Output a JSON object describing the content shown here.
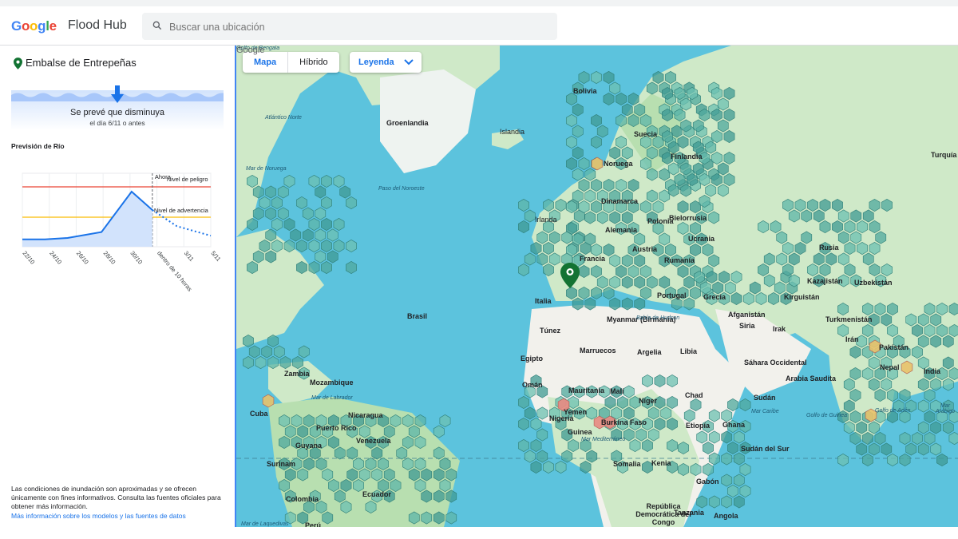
{
  "header": {
    "logo_letters": [
      "G",
      "o",
      "o",
      "g",
      "l",
      "e"
    ],
    "logo_colors": [
      "#4285f4",
      "#ea4335",
      "#fbbc05",
      "#4285f4",
      "#34a853",
      "#ea4335"
    ],
    "product": "Flood Hub",
    "search_placeholder": "Buscar una ubicación"
  },
  "sidebar": {
    "location": "Embalse de Entrepeñas",
    "forecast_title": "Se prevé que disminuya",
    "forecast_sub": "el día 6/11 o antes",
    "section_label": "Previsión de Río",
    "disclaimer": "Las condiciones de inundación son aproximadas y se ofrecen únicamente con fines informativos. Consulta las fuentes oficiales para obtener más información.",
    "more_link": "Más información sobre los modelos y las fuentes de datos"
  },
  "chart_data": {
    "type": "line",
    "x": [
      "22/10",
      "24/10",
      "26/10",
      "28/10",
      "30/10",
      "dentro de 10 horas",
      "3/11",
      "5/11"
    ],
    "annotations": [
      "Ahora",
      "Nivel de peligro",
      "Nivel de advertencia"
    ],
    "danger_color": "#ea4335",
    "warning_color": "#fbbc05",
    "line_color": "#1a73e8",
    "series": [
      {
        "values": [
          0.1,
          0.1,
          0.12,
          0.2,
          0.75,
          0.5
        ]
      },
      {
        "values": [
          0.5,
          0.28,
          0.15
        ]
      }
    ]
  },
  "map": {
    "view_tabs": [
      "Mapa",
      "Híbrido"
    ],
    "legend_label": "Leyenda",
    "labels": [
      {
        "t": "Groenlandia",
        "b": true
      },
      {
        "t": "Islandia"
      },
      {
        "t": "Irlanda"
      },
      {
        "t": "Noruega",
        "b": true
      },
      {
        "t": "Suecia",
        "b": true
      },
      {
        "t": "Finlandia",
        "b": true
      },
      {
        "t": "Dinamarca",
        "b": true
      },
      {
        "t": "Polonia",
        "b": true
      },
      {
        "t": "Alemania",
        "b": true
      },
      {
        "t": "Bielorrusia",
        "b": true
      },
      {
        "t": "Ucrania",
        "b": true
      },
      {
        "t": "Francia",
        "b": true
      },
      {
        "t": "Austria",
        "b": true
      },
      {
        "t": "Rumanía",
        "b": true
      },
      {
        "t": "Italia",
        "b": true
      },
      {
        "t": "Portugal",
        "b": true
      },
      {
        "t": "Grecia",
        "b": true
      },
      {
        "t": "Turquía",
        "b": true
      },
      {
        "t": "Rusia",
        "b": true
      },
      {
        "t": "Kazajistán",
        "b": true
      },
      {
        "t": "Uzbekistán",
        "b": true
      },
      {
        "t": "Kirguistán",
        "b": true
      },
      {
        "t": "Turkmenistán",
        "b": true
      },
      {
        "t": "Afganistán",
        "b": true
      },
      {
        "t": "Siria",
        "b": true
      },
      {
        "t": "Irak",
        "b": true
      },
      {
        "t": "Irán",
        "b": true
      },
      {
        "t": "Pakistán",
        "b": true
      },
      {
        "t": "Nepal",
        "b": true
      },
      {
        "t": "India",
        "b": true
      },
      {
        "t": "Myanmar (Birmania)",
        "b": true
      },
      {
        "t": "Túnez",
        "b": true
      },
      {
        "t": "Marruecos",
        "b": true
      },
      {
        "t": "Argelia",
        "b": true
      },
      {
        "t": "Libia",
        "b": true
      },
      {
        "t": "Egipto",
        "b": true
      },
      {
        "t": "Sáhara Occidental",
        "b": true
      },
      {
        "t": "Arabia Saudita",
        "b": true
      },
      {
        "t": "Omán",
        "b": true
      },
      {
        "t": "Mauritania",
        "b": true
      },
      {
        "t": "Malí",
        "b": true
      },
      {
        "t": "Níger",
        "b": true
      },
      {
        "t": "Chad",
        "b": true
      },
      {
        "t": "Sudán",
        "b": true
      },
      {
        "t": "Yemen",
        "b": true
      },
      {
        "t": "Burkina Faso",
        "b": true
      },
      {
        "t": "Nigeria",
        "b": true
      },
      {
        "t": "Guinea",
        "b": true
      },
      {
        "t": "Ghana",
        "b": true
      },
      {
        "t": "Etiopía",
        "b": true
      },
      {
        "t": "Sudán del Sur",
        "b": true
      },
      {
        "t": "Somalia",
        "b": true
      },
      {
        "t": "Kenia",
        "b": true
      },
      {
        "t": "Gabón",
        "b": true
      },
      {
        "t": "República Democrática del Congo",
        "b": true
      },
      {
        "t": "Tanzania",
        "b": true
      },
      {
        "t": "Angola",
        "b": true
      },
      {
        "t": "Zambia",
        "b": true
      },
      {
        "t": "Mozambique",
        "b": true
      },
      {
        "t": "Cuba",
        "b": true
      },
      {
        "t": "Puerto Rico",
        "b": true
      },
      {
        "t": "Nicaragua",
        "b": true
      },
      {
        "t": "Venezuela",
        "b": true
      },
      {
        "t": "Guyana",
        "b": true
      },
      {
        "t": "Surinam",
        "b": true
      },
      {
        "t": "Colombia",
        "b": true
      },
      {
        "t": "Ecuador",
        "b": true
      },
      {
        "t": "Perú",
        "b": true
      },
      {
        "t": "Brasil",
        "b": true
      },
      {
        "t": "Bolivia",
        "b": true
      },
      {
        "t": "Atlántico Norte",
        "sea": true
      },
      {
        "t": "Mar de Noruega",
        "sea": true
      },
      {
        "t": "Paso del Noroeste",
        "sea": true
      },
      {
        "t": "Bahía de Hudson",
        "sea": true
      },
      {
        "t": "Mar de Labrador",
        "sea": true
      },
      {
        "t": "Mar Mediterráneo",
        "sea": true
      },
      {
        "t": "Mar Caribe",
        "sea": true
      },
      {
        "t": "Golfo de Guinea",
        "sea": true
      },
      {
        "t": "Golfo de Adén",
        "sea": true
      },
      {
        "t": "Mar Arábigo",
        "sea": true
      },
      {
        "t": "Mar de Laquedivas",
        "sea": true
      },
      {
        "t": "Golfo de Bengala",
        "sea": true
      },
      {
        "t": "Google"
      }
    ]
  }
}
